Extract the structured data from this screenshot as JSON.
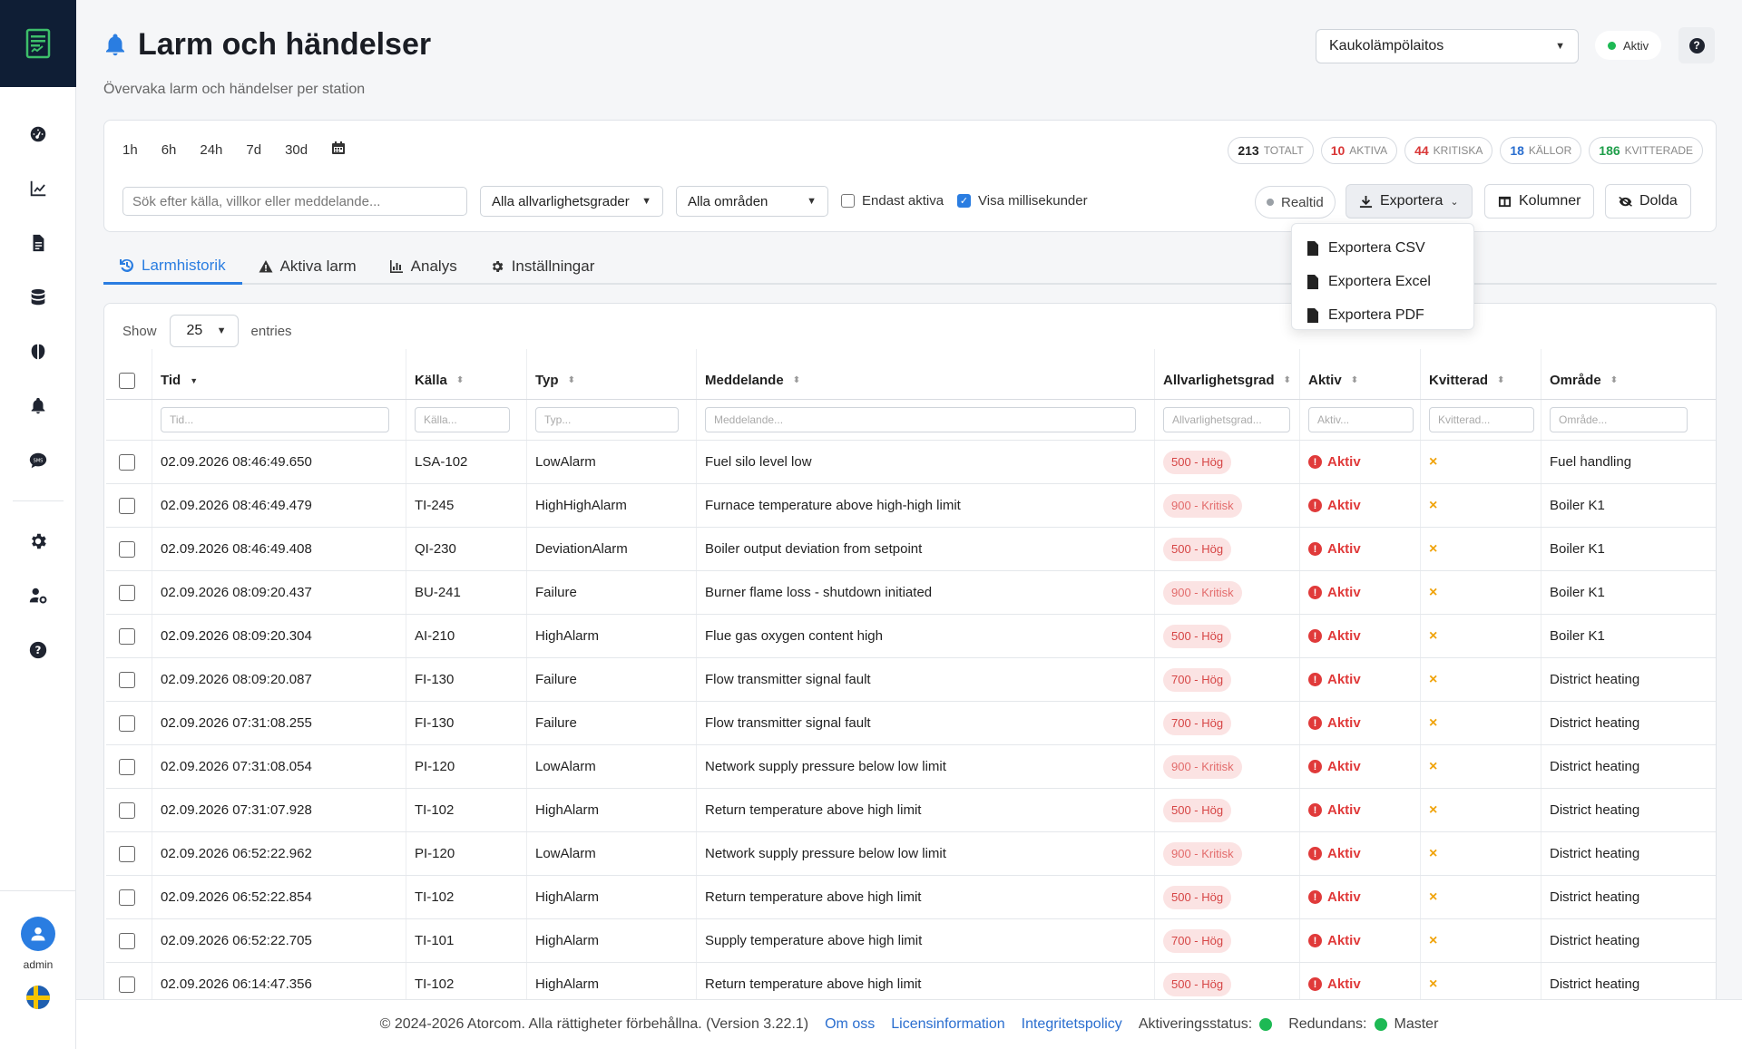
{
  "header": {
    "title": "Larm och händelser",
    "subtitle": "Övervaka larm och händelser per station",
    "station": "Kaukolämpölaitos",
    "status": "Aktiv",
    "help": "?"
  },
  "user": {
    "name": "admin"
  },
  "filters": {
    "time_buttons": [
      "1h",
      "6h",
      "24h",
      "7d",
      "30d"
    ],
    "counts": [
      {
        "value": "213",
        "label": "TOTALT",
        "color": "#222222"
      },
      {
        "value": "10",
        "label": "AKTIVA",
        "color": "#d93636"
      },
      {
        "value": "44",
        "label": "KRITISKA",
        "color": "#d93636"
      },
      {
        "value": "18",
        "label": "KÄLLOR",
        "color": "#2a6ecf"
      },
      {
        "value": "186",
        "label": "KVITTERADE",
        "color": "#1f9e4a"
      }
    ],
    "search_placeholder": "Sök efter källa, villkor eller meddelande...",
    "severity_select": "Alla allvarlighetsgrader",
    "area_select": "Alla områden",
    "only_active": "Endast aktiva",
    "show_ms": "Visa millisekunder",
    "realtime": "Realtid",
    "export": "Exportera",
    "columns": "Kolumner",
    "hidden": "Dolda"
  },
  "export_menu": [
    "Exportera CSV",
    "Exportera Excel",
    "Exportera PDF"
  ],
  "tabs": [
    "Larmhistorik",
    "Aktiva larm",
    "Analys",
    "Inställningar"
  ],
  "table": {
    "show_label": "Show",
    "entries_value": "25",
    "entries_label": "entries",
    "columns": [
      "Tid",
      "Källa",
      "Typ",
      "Meddelande",
      "Allvarlighetsgrad",
      "Aktiv",
      "Kvitterad",
      "Område"
    ],
    "filter_placeholders": [
      "Tid...",
      "Källa...",
      "Typ...",
      "Meddelande...",
      "Allvarlighetsgrad...",
      "Aktiv...",
      "Kvitterad...",
      "Område..."
    ],
    "rows": [
      {
        "tid": "02.09.2026 08:46:49.650",
        "kalla": "LSA-102",
        "typ": "LowAlarm",
        "meddelande": "Fuel silo level low",
        "sev": "500 - Hög",
        "aktiv": "Aktiv",
        "kvitterad": "×",
        "omrade": "Fuel handling"
      },
      {
        "tid": "02.09.2026 08:46:49.479",
        "kalla": "TI-245",
        "typ": "HighHighAlarm",
        "meddelande": "Furnace temperature above high-high limit",
        "sev": "900 - Kritisk",
        "aktiv": "Aktiv",
        "kvitterad": "×",
        "omrade": "Boiler K1"
      },
      {
        "tid": "02.09.2026 08:46:49.408",
        "kalla": "QI-230",
        "typ": "DeviationAlarm",
        "meddelande": "Boiler output deviation from setpoint",
        "sev": "500 - Hög",
        "aktiv": "Aktiv",
        "kvitterad": "×",
        "omrade": "Boiler K1"
      },
      {
        "tid": "02.09.2026 08:09:20.437",
        "kalla": "BU-241",
        "typ": "Failure",
        "meddelande": "Burner flame loss - shutdown initiated",
        "sev": "900 - Kritisk",
        "aktiv": "Aktiv",
        "kvitterad": "×",
        "omrade": "Boiler K1"
      },
      {
        "tid": "02.09.2026 08:09:20.304",
        "kalla": "AI-210",
        "typ": "HighAlarm",
        "meddelande": "Flue gas oxygen content high",
        "sev": "500 - Hög",
        "aktiv": "Aktiv",
        "kvitterad": "×",
        "omrade": "Boiler K1"
      },
      {
        "tid": "02.09.2026 08:09:20.087",
        "kalla": "FI-130",
        "typ": "Failure",
        "meddelande": "Flow transmitter signal fault",
        "sev": "700 - Hög",
        "aktiv": "Aktiv",
        "kvitterad": "×",
        "omrade": "District heating"
      },
      {
        "tid": "02.09.2026 07:31:08.255",
        "kalla": "FI-130",
        "typ": "Failure",
        "meddelande": "Flow transmitter signal fault",
        "sev": "700 - Hög",
        "aktiv": "Aktiv",
        "kvitterad": "×",
        "omrade": "District heating"
      },
      {
        "tid": "02.09.2026 07:31:08.054",
        "kalla": "PI-120",
        "typ": "LowAlarm",
        "meddelande": "Network supply pressure below low limit",
        "sev": "900 - Kritisk",
        "aktiv": "Aktiv",
        "kvitterad": "×",
        "omrade": "District heating"
      },
      {
        "tid": "02.09.2026 07:31:07.928",
        "kalla": "TI-102",
        "typ": "HighAlarm",
        "meddelande": "Return temperature above high limit",
        "sev": "500 - Hög",
        "aktiv": "Aktiv",
        "kvitterad": "×",
        "omrade": "District heating"
      },
      {
        "tid": "02.09.2026 06:52:22.962",
        "kalla": "PI-120",
        "typ": "LowAlarm",
        "meddelande": "Network supply pressure below low limit",
        "sev": "900 - Kritisk",
        "aktiv": "Aktiv",
        "kvitterad": "×",
        "omrade": "District heating"
      },
      {
        "tid": "02.09.2026 06:52:22.854",
        "kalla": "TI-102",
        "typ": "HighAlarm",
        "meddelande": "Return temperature above high limit",
        "sev": "500 - Hög",
        "aktiv": "Aktiv",
        "kvitterad": "×",
        "omrade": "District heating"
      },
      {
        "tid": "02.09.2026 06:52:22.705",
        "kalla": "TI-101",
        "typ": "HighAlarm",
        "meddelande": "Supply temperature above high limit",
        "sev": "700 - Hög",
        "aktiv": "Aktiv",
        "kvitterad": "×",
        "omrade": "District heating"
      },
      {
        "tid": "02.09.2026 06:14:47.356",
        "kalla": "TI-102",
        "typ": "HighAlarm",
        "meddelande": "Return temperature above high limit",
        "sev": "500 - Hög",
        "aktiv": "Aktiv",
        "kvitterad": "×",
        "omrade": "District heating"
      }
    ]
  },
  "footer": {
    "copyright": "© 2024-2026 Atorcom. Alla rättigheter förbehållna. (Version 3.22.1)",
    "links": [
      "Om oss",
      "Licensinformation",
      "Integritetspolicy"
    ],
    "activation": "Aktiveringsstatus:",
    "redundancy": "Redundans:",
    "master": "Master"
  }
}
